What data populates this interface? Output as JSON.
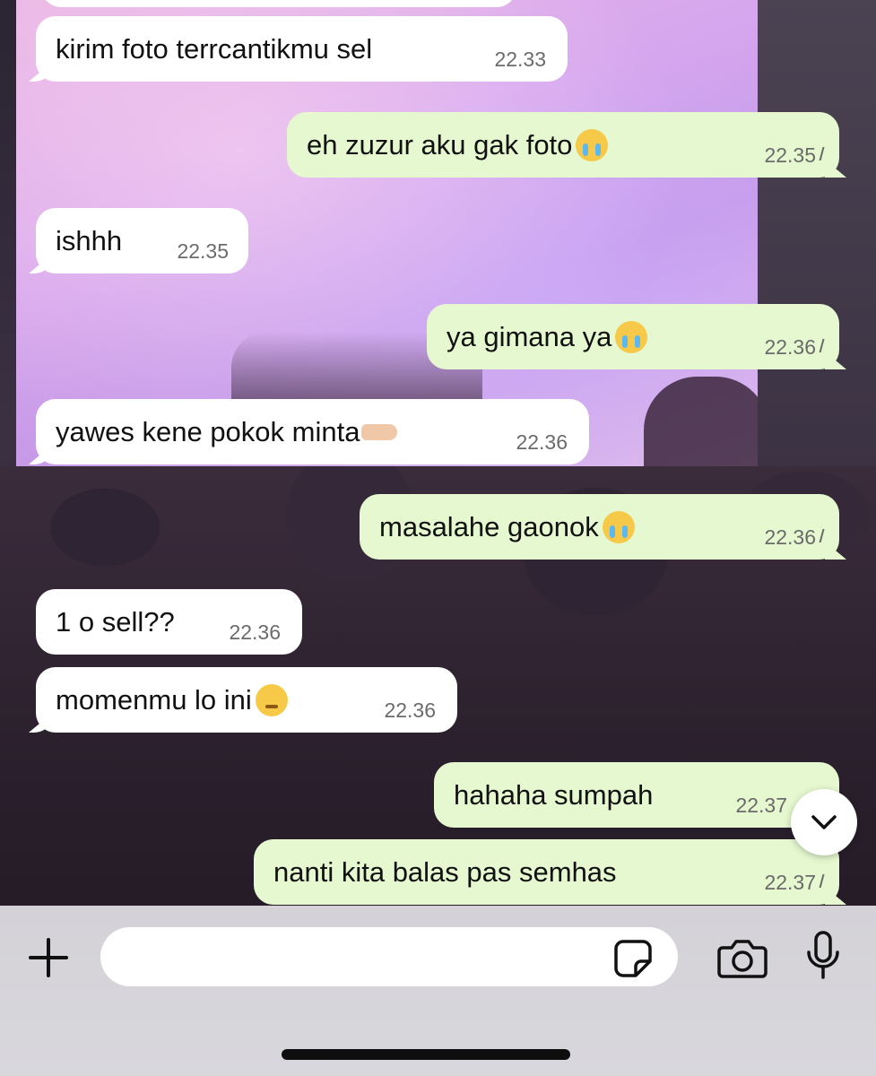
{
  "messages": [
    {
      "direction": "incoming",
      "text": "kirim foto terrcantikmu sel",
      "emoji": "",
      "time": "22.33",
      "read": false
    },
    {
      "direction": "outgoing",
      "text": "eh zuzur aku gak foto",
      "emoji": "loudly-crying-face",
      "time": "22.35",
      "read": true
    },
    {
      "direction": "incoming",
      "text": "ishhh",
      "emoji": "",
      "time": "22.35",
      "read": false
    },
    {
      "direction": "outgoing",
      "text": "ya gimana ya",
      "emoji": "loudly-crying-face",
      "time": "22.36",
      "read": true
    },
    {
      "direction": "incoming",
      "text": "yawes kene pokok minta",
      "emoji": "palm-up-hand",
      "time": "22.36",
      "read": false
    },
    {
      "direction": "outgoing",
      "text": "masalahe gaonok",
      "emoji": "loudly-crying-face",
      "time": "22.36",
      "read": true
    },
    {
      "direction": "incoming",
      "text": "1 o sell??",
      "emoji": "",
      "time": "22.36",
      "read": false
    },
    {
      "direction": "incoming",
      "text": "momenmu lo ini",
      "emoji": "pensive-face",
      "time": "22.36",
      "read": false
    },
    {
      "direction": "outgoing",
      "text": "hahaha sumpah",
      "emoji": "",
      "time": "22.37",
      "read": true
    },
    {
      "direction": "outgoing",
      "text": "nanti kita balas pas semhas",
      "emoji": "",
      "time": "22.37",
      "read": true
    }
  ],
  "read_ticks": "//",
  "input": {
    "value": "",
    "placeholder": ""
  },
  "icons": {
    "plus": "plus-icon",
    "sticker": "sticker-icon",
    "camera": "camera-icon",
    "mic": "microphone-icon",
    "scroll_down": "chevron-down-icon"
  },
  "colors": {
    "incoming_bubble": "#ffffff",
    "outgoing_bubble": "#e5f8cf",
    "timestamp": "#6b6b6b",
    "input_bar": "#d6d5da"
  }
}
